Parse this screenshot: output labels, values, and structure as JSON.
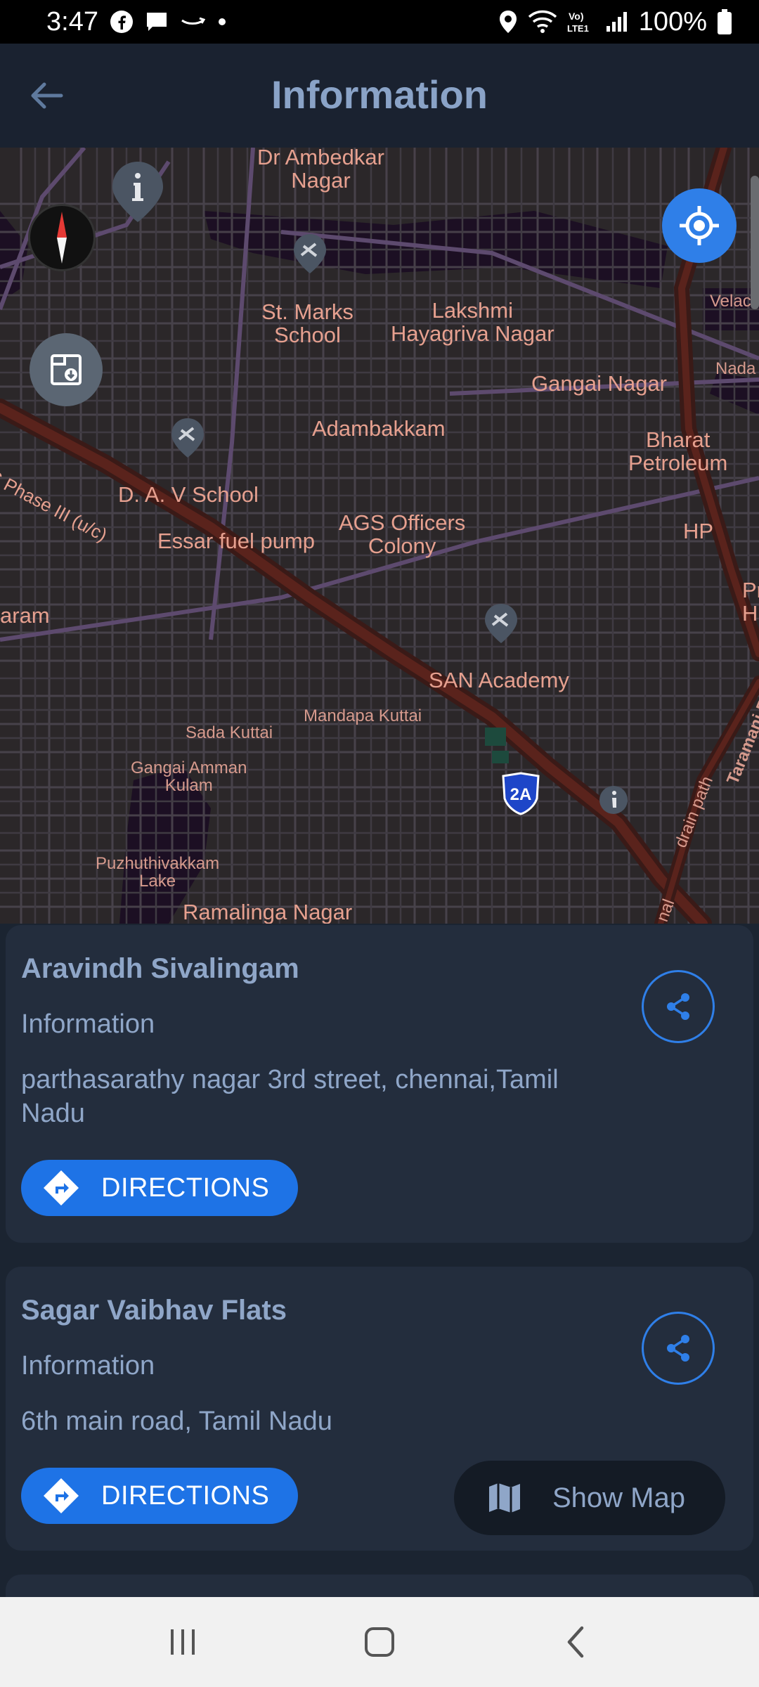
{
  "status_bar": {
    "time": "3:47",
    "battery": "100%",
    "left_icons": [
      "facebook-icon",
      "message-icon",
      "amazon-icon",
      "dot-icon"
    ],
    "right_icons": [
      "location-icon",
      "wifi-icon",
      "volte-icon",
      "signal-icon",
      "battery-icon"
    ]
  },
  "app_bar": {
    "title": "Information",
    "back_icon": "arrow-left-icon"
  },
  "map": {
    "labels": {
      "dr_ambedkar": "Dr Ambedkar\nNagar",
      "st_marks": "St. Marks\nSchool",
      "lakshmi": "Lakshmi\nHayagriva Nagar",
      "velac": "Velac",
      "nada": "Nada",
      "gangai_nagar": "Gangai Nagar",
      "adambakkam": "Adambakkam",
      "bharat": "Bharat\nPetroleum",
      "phase": "S Phase III (u/c)",
      "dav": "D. A. V School",
      "essar": "Essar fuel pump",
      "ags": "AGS Officers\nColony",
      "hp": "HP",
      "pr": "Pr\nH",
      "aram": "aram",
      "san": "SAN Academy",
      "mandapa": "Mandapa Kuttai",
      "sada": "Sada Kuttai",
      "gangai_amman": "Gangai Amman\nKulam",
      "taramani": "Taramani R",
      "drain": "drain path",
      "puzhuthivakkam": "Puzhuthivakkam\nLake",
      "ramalinga": "Ramalinga Nagar",
      "nal": "nal",
      "shield": "2A"
    },
    "icons": {
      "compass": "compass-icon",
      "locate": "my-location-icon",
      "layers": "map-layers-icon",
      "info": "info-pin-icon"
    }
  },
  "places": [
    {
      "name": "Aravindh Sivalingam",
      "category": "Information",
      "address": "parthasarathy nagar 3rd street, chennai,Tamil Nadu",
      "directions_label": "DIRECTIONS"
    },
    {
      "name": "Sagar Vaibhav Flats",
      "category": "Information",
      "address": "6th main road, Tamil Nadu",
      "directions_label": "DIRECTIONS"
    }
  ],
  "show_map": {
    "label": "Show Map"
  },
  "nav_bar": {
    "icons": [
      "recents-icon",
      "home-icon",
      "back-icon"
    ]
  },
  "colors": {
    "accent": "#2f7fe8",
    "card_bg": "#232d3d",
    "text": "#8fa6c8",
    "map_label": "#e6a08f"
  }
}
